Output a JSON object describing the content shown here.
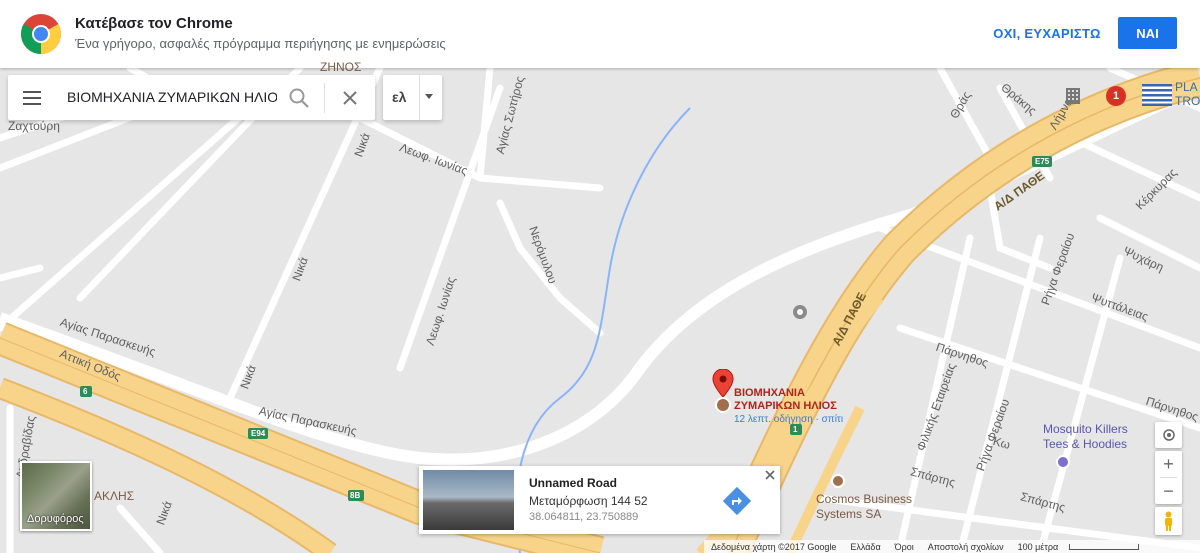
{
  "promo": {
    "title": "Κατέβασε τον Chrome",
    "subtitle": "Ένα γρήγορο, ασφαλές πρόγραμμα περιήγησης με ενημερώσεις",
    "decline_label": "ΟΧΙ, ΕΥΧΑΡΙΣΤΩ",
    "accept_label": "ΝΑΙ"
  },
  "search": {
    "query": "ΒΙΟΜΗΧΑΝΙΑ ΖΥΜΑΡΙΚΩΝ ΗΛΙΟΣ",
    "language": "ελ"
  },
  "place": {
    "name_line1": "ΒΙΟΜΗΧΑΝΙΑ",
    "name_line2": "ΖΥΜΑΡΙΚΩΝ ΗΛΙΟΣ",
    "eta": "12 λεπτ. οδήγηση · σπίτι"
  },
  "card": {
    "road": "Unnamed Road",
    "address": "Μεταμόρφωση 144 52",
    "coords": "38.064811, 23.750889"
  },
  "satellite_label": "Δορυφόρος",
  "notifications_count": "1",
  "store_label_line1": "PLA",
  "store_label_line2": "TRON",
  "pois": {
    "cosmos_line1": "Cosmos Business",
    "cosmos_line2": "Systems SA",
    "mosquito_line1": "Mosquito Killers",
    "mosquito_line2": "Tees & Hoodies",
    "left_poi": "ΑΚΛΗΣ",
    "top_poi": "ΖΗΝΟΣ"
  },
  "streets": {
    "zaxtouri": "Ζαχτούρη",
    "leof_ionias": "Λεωφ. Ιωνίας",
    "agias_sotiros": "Αγίας Σωτήρος",
    "nika": "Νικά",
    "neromylou": "Νερόμυλου",
    "agias_paraskevis": "Αγίας Παρασκευής",
    "attiki_odos": "Αττική Οδός",
    "ad_pathe": "Α/Δ ΠΑΘΕ",
    "thraki": "Θράκης",
    "thras": "Θράς",
    "kerkyras": "Κέρκυρας",
    "psyxari": "Ψυχάρη",
    "psyttaleias": "Ψυττάλειας",
    "rigas_feraiou": "Ρήγα Φεραίου",
    "parnithos": "Πάρνηθος",
    "filikis_etaireias": "Φιλικής Εταιρείας",
    "spartis": "Σπάρτης",
    "ko": "Κω",
    "andravidas": "Ανδραβίδας",
    "limnou": "Λήμνου",
    "shield_e75": "E75",
    "shield_e94": "E94",
    "shield_6": "6",
    "shield_8b": "8B",
    "shield_1": "1"
  },
  "footer": {
    "map_data": "Δεδομένα χάρτη ©2017 Google",
    "country": "Ελλάδα",
    "terms": "Όροι",
    "feedback": "Αποστολή σχολίων",
    "scale": "100 μέτρα"
  },
  "colors": {
    "accent": "#1a73e8",
    "highway": "#f7d48a",
    "pin": "#ea4335",
    "place_text": "#b0231b"
  }
}
